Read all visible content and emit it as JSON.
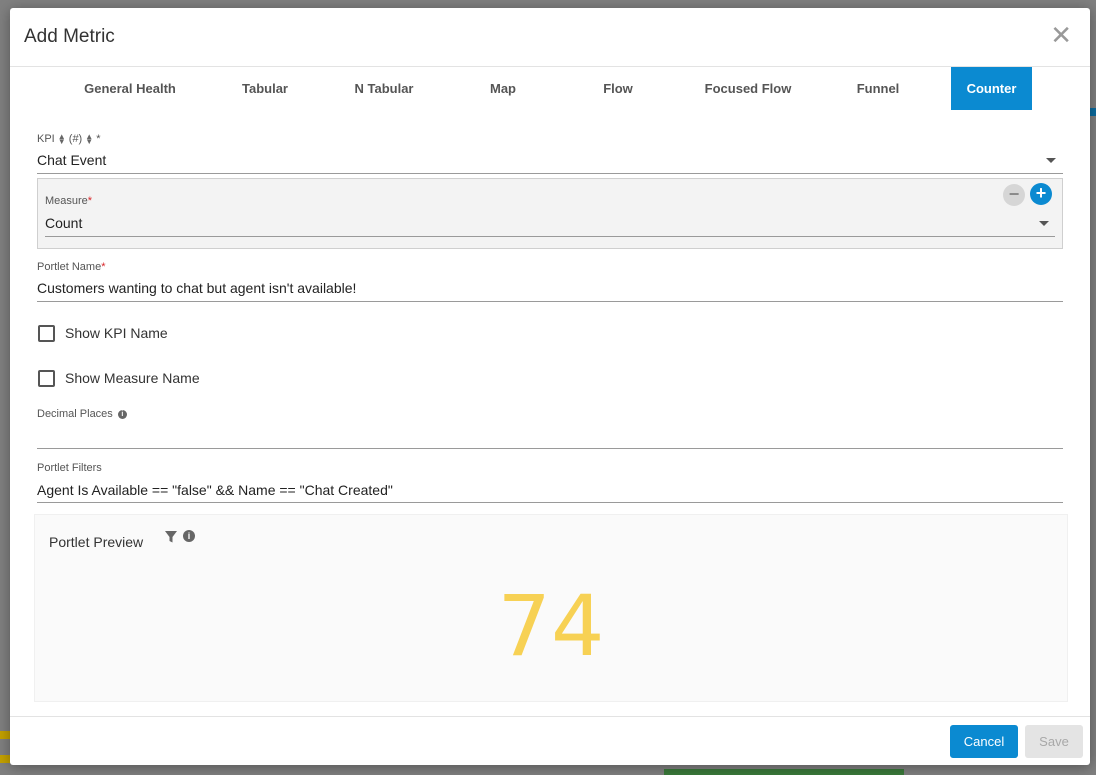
{
  "modal": {
    "title": "Add Metric",
    "close_glyph": "✕"
  },
  "tabs": [
    {
      "label": "General Health",
      "active": false
    },
    {
      "label": "Tabular",
      "active": false
    },
    {
      "label": "N Tabular",
      "active": false
    },
    {
      "label": "Map",
      "active": false
    },
    {
      "label": "Flow",
      "active": false
    },
    {
      "label": "Focused Flow",
      "active": false
    },
    {
      "label": "Funnel",
      "active": false
    },
    {
      "label": "Counter",
      "active": true
    }
  ],
  "kpi": {
    "label": "KPI",
    "label_mid": "(#)",
    "required_mark": "*",
    "value": "Chat Event"
  },
  "measure": {
    "label": "Measure",
    "required_mark": "*",
    "value": "Count",
    "remove_glyph": "−",
    "add_glyph": "+"
  },
  "portlet_name": {
    "label": "Portlet Name",
    "required_mark": "*",
    "value": "Customers wanting to chat but agent isn't available!"
  },
  "show_kpi_name": {
    "label": "Show KPI Name",
    "checked": false
  },
  "show_measure_name": {
    "label": "Show Measure Name",
    "checked": false
  },
  "decimal_places": {
    "label": "Decimal Places",
    "value": ""
  },
  "portlet_filters": {
    "label": "Portlet Filters",
    "value": "Agent Is Available == \"false\" && Name == \"Chat Created\""
  },
  "preview": {
    "title": "Portlet Preview",
    "counter_value": "74",
    "counter_color": "#f7d154"
  },
  "footer": {
    "cancel_label": "Cancel",
    "save_label": "Save"
  },
  "colors": {
    "accent": "#0b8ad1",
    "required": "#d9262a"
  },
  "icons": {
    "close": "close-icon",
    "filter": "filter-icon",
    "info": "info-icon",
    "caret": "chevron-down-icon",
    "sort": "sort-icon"
  }
}
